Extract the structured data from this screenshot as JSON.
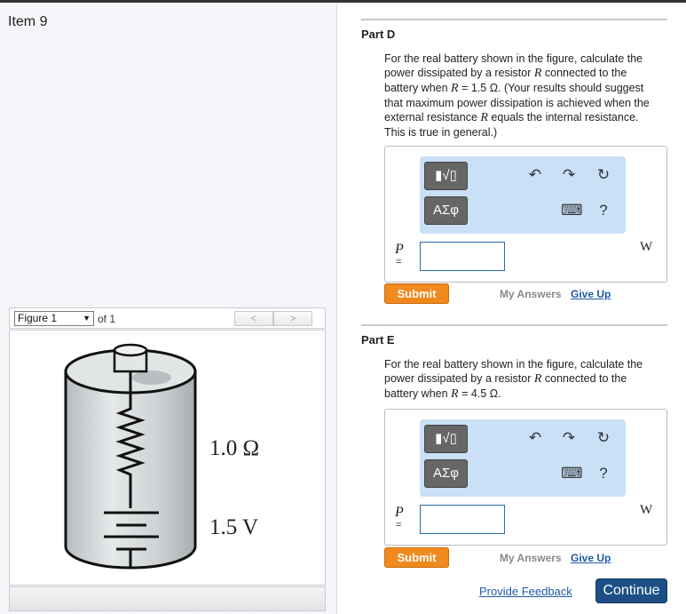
{
  "item": {
    "title": "Item 9"
  },
  "figure": {
    "select_value": "Figure 1",
    "of_text": "of 1",
    "prev_label": "<",
    "next_label": ">",
    "resistance_label": "1.0 Ω",
    "voltage_label": "1.5 V"
  },
  "parts": [
    {
      "title": "Part D",
      "question_pre": "For the real battery shown in the figure, calculate the power dissipated by a resistor ",
      "var_r1": "R",
      "question_mid": " connected to the battery when ",
      "var_r2": "R",
      "question_val": " = 1.5  Ω",
      "question_post": ". (Your results should suggest that maximum power dissipation is achieved when the external resistance ",
      "var_r3": "R",
      "question_end": " equals the internal resistance. This is true in general.)",
      "toolbar": {
        "template_label": "▮√▯",
        "greek_label": "ΑΣφ",
        "undo": "↶",
        "redo": "↷",
        "reset": "↻",
        "keyboard": "⌨",
        "help": "?"
      },
      "variable": "P",
      "equals": "=",
      "input_value": "",
      "unit": "W",
      "submit_label": "Submit",
      "my_answers_label": "My Answers",
      "give_up_label": "Give Up"
    },
    {
      "title": "Part E",
      "question_pre": "For the real battery shown in the figure, calculate the power dissipated by a resistor ",
      "var_r1": "R",
      "question_mid": " connected to the battery when ",
      "var_r2": "R",
      "question_val": " = 4.5  Ω",
      "question_end": ".",
      "toolbar": {
        "template_label": "▮√▯",
        "greek_label": "ΑΣφ",
        "undo": "↶",
        "redo": "↷",
        "reset": "↻",
        "keyboard": "⌨",
        "help": "?"
      },
      "variable": "P",
      "equals": "=",
      "input_value": "",
      "unit": "W",
      "submit_label": "Submit",
      "my_answers_label": "My Answers",
      "give_up_label": "Give Up"
    }
  ],
  "footer": {
    "feedback_label": "Provide Feedback",
    "continue_label": "Continue"
  }
}
